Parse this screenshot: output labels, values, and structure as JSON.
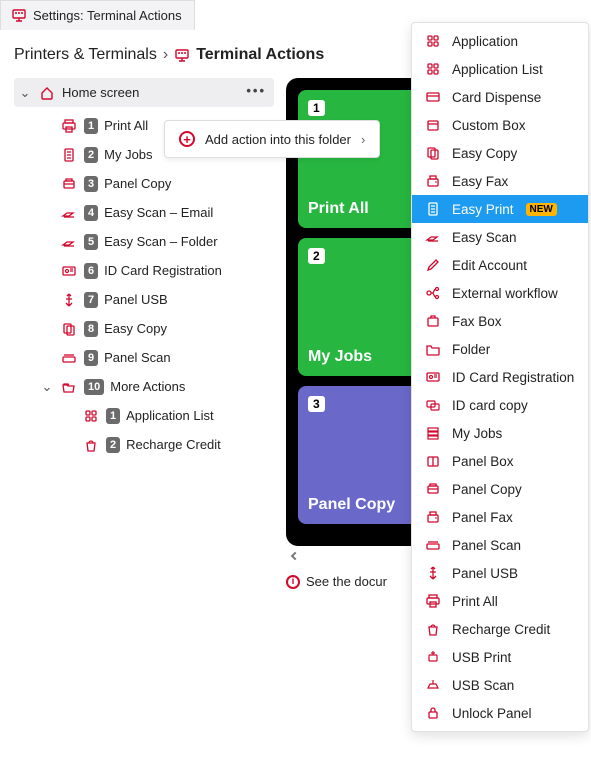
{
  "colors": {
    "accent": "#d2082d",
    "blue": "#1d9bf0",
    "badge": "#ffb400",
    "tileGreen": "#27b740",
    "tilePurple": "#6a69c9"
  },
  "tab": {
    "title": "Settings: Terminal Actions"
  },
  "breadcrumb": {
    "first": "Printers & Terminals",
    "last": "Terminal Actions"
  },
  "root": {
    "label": "Home screen"
  },
  "tree": [
    {
      "num": "1",
      "label": "Print All",
      "icon": "printer"
    },
    {
      "num": "2",
      "label": "My Jobs",
      "icon": "doc"
    },
    {
      "num": "3",
      "label": "Panel Copy",
      "icon": "copier"
    },
    {
      "num": "4",
      "label": "Easy Scan – Email",
      "icon": "scan"
    },
    {
      "num": "5",
      "label": "Easy Scan – Folder",
      "icon": "scan"
    },
    {
      "num": "6",
      "label": "ID Card Registration",
      "icon": "idcard"
    },
    {
      "num": "7",
      "label": "Panel USB",
      "icon": "usb"
    },
    {
      "num": "8",
      "label": "Easy Copy",
      "icon": "copy"
    },
    {
      "num": "9",
      "label": "Panel Scan",
      "icon": "scanflat"
    }
  ],
  "more": {
    "num": "10",
    "label": "More Actions",
    "children": [
      {
        "num": "1",
        "label": "Application List",
        "icon": "grid"
      },
      {
        "num": "2",
        "label": "Recharge Credit",
        "icon": "bag"
      }
    ]
  },
  "addAction": {
    "label": "Add action into this folder"
  },
  "tiles": [
    {
      "num": "1",
      "label": "Print All",
      "color": "green"
    },
    {
      "num": "2",
      "label": "My Jobs",
      "color": "green"
    },
    {
      "num": "3",
      "label": "Panel Copy",
      "color": "purple"
    }
  ],
  "docline": "See the docur",
  "menu": [
    {
      "label": "Application",
      "icon": "grid"
    },
    {
      "label": "Application List",
      "icon": "grid"
    },
    {
      "label": "Card Dispense",
      "icon": "card"
    },
    {
      "label": "Custom Box",
      "icon": "box"
    },
    {
      "label": "Easy Copy",
      "icon": "copy"
    },
    {
      "label": "Easy Fax",
      "icon": "fax"
    },
    {
      "label": "Easy Print",
      "icon": "doc",
      "selected": true,
      "badge": "NEW"
    },
    {
      "label": "Easy Scan",
      "icon": "scan"
    },
    {
      "label": "Edit Account",
      "icon": "edit"
    },
    {
      "label": "External workflow",
      "icon": "flow"
    },
    {
      "label": "Fax Box",
      "icon": "faxbox"
    },
    {
      "label": "Folder",
      "icon": "folder"
    },
    {
      "label": "ID Card Registration",
      "icon": "idcard"
    },
    {
      "label": "ID card copy",
      "icon": "idcopy"
    },
    {
      "label": "My Jobs",
      "icon": "stack"
    },
    {
      "label": "Panel Box",
      "icon": "pbox"
    },
    {
      "label": "Panel Copy",
      "icon": "copier"
    },
    {
      "label": "Panel Fax",
      "icon": "fax"
    },
    {
      "label": "Panel Scan",
      "icon": "scanflat"
    },
    {
      "label": "Panel USB",
      "icon": "usb"
    },
    {
      "label": "Print All",
      "icon": "printer"
    },
    {
      "label": "Recharge Credit",
      "icon": "bag"
    },
    {
      "label": "USB Print",
      "icon": "usbprint"
    },
    {
      "label": "USB Scan",
      "icon": "usbscan"
    },
    {
      "label": "Unlock Panel",
      "icon": "lock"
    }
  ]
}
